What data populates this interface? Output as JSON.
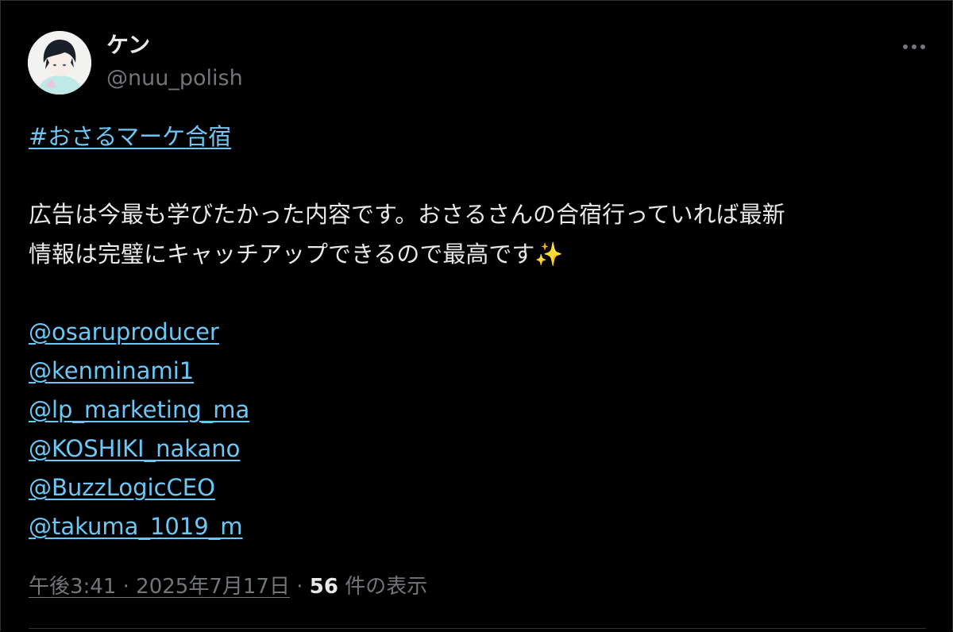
{
  "tweet": {
    "author": {
      "display_name": "ケン",
      "handle": "@nuu_polish",
      "avatar_icon": "user-avatar-illustration"
    },
    "more_icon": "more-horizontal-icon",
    "hashtag": "#おさるマーケ合宿",
    "text_lines": [
      "広告は今最も学びたかった内容です。おさるさんの合宿行っていれば最新",
      "情報は完璧にキャッチアップできるので最高です✨"
    ],
    "mentions": [
      "@osaruproducer",
      "@kenminami1",
      "@lp_marketing_ma",
      "@KOSHIKI_nakano",
      "@BuzzLogicCEO",
      "@takuma_1019_m"
    ],
    "timestamp": "午後3:41 · 2025年7月17日",
    "separator": "·",
    "view_count": "56",
    "view_label": "件の表示"
  },
  "colors": {
    "background": "#000000",
    "text": "#e7e9ea",
    "muted": "#71767b",
    "link": "#6cc7f5",
    "border": "#2f3336"
  }
}
